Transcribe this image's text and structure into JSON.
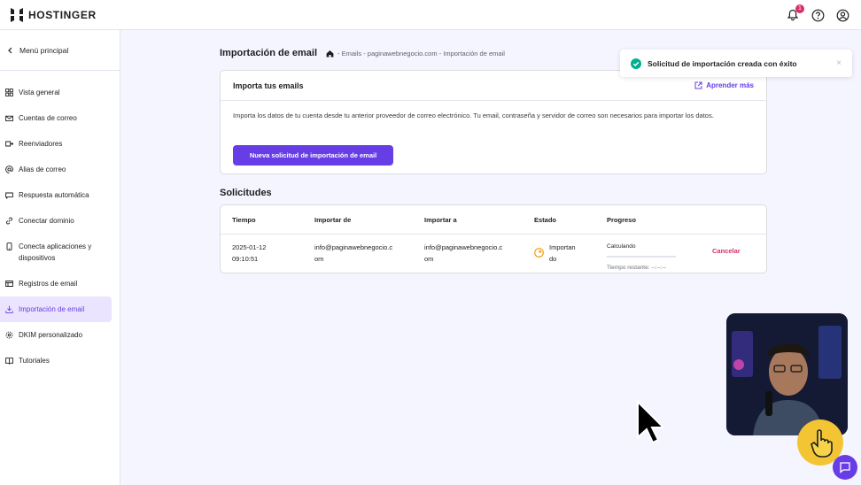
{
  "brand": {
    "name": "HOSTINGER"
  },
  "topbar": {
    "notification_count": "1"
  },
  "sidebar": {
    "back_label": "Menú principal",
    "items": [
      {
        "label": "Vista general",
        "icon": "dashboard-icon"
      },
      {
        "label": "Cuentas de correo",
        "icon": "mail-icon"
      },
      {
        "label": "Reenviadores",
        "icon": "forward-icon"
      },
      {
        "label": "Alias de correo",
        "icon": "at-icon"
      },
      {
        "label": "Respuesta automática",
        "icon": "reply-icon"
      },
      {
        "label": "Conectar dominio",
        "icon": "link-icon"
      },
      {
        "label": "Conecta aplicaciones y dispositivos",
        "icon": "devices-icon"
      },
      {
        "label": "Registros de email",
        "icon": "records-icon"
      },
      {
        "label": "Importación de email",
        "icon": "import-icon",
        "active": true
      },
      {
        "label": "DKIM personalizado",
        "icon": "gear-icon"
      },
      {
        "label": "Tutoriales",
        "icon": "book-icon"
      }
    ]
  },
  "header": {
    "title": "Importación de email",
    "breadcrumb": "- Emails - paginawebnegocio.com - Importación de email"
  },
  "import_card": {
    "title": "Importa tus emails",
    "learn_more": "Aprender más",
    "description": "Importa los datos de tu cuenta desde tu anterior proveedor de correo electrónico. Tu email, contraseña y servidor de correo son necesarios para importar los datos.",
    "button": "Nueva solicitud de importación de email"
  },
  "requests": {
    "title": "Solicitudes",
    "columns": [
      "Tiempo",
      "Importar de",
      "Importar a",
      "Estado",
      "Progreso"
    ],
    "rows": [
      {
        "time_line1": "2025-01-12",
        "time_line2": "09:10:51",
        "from_line1": "info@paginawebnegocio.c",
        "from_line2": "om",
        "to_line1": "info@paginawebnegocio.c",
        "to_line2": "om",
        "status_line1": "Importan",
        "status_line2": "do",
        "progress_label": "Calculando",
        "progress_fraction": 0,
        "remaining": "Tiempo restante: --:--:--",
        "cancel": "Cancelar"
      }
    ]
  },
  "toast": {
    "message": "Solicitud de importación creada con éxito",
    "close": "×"
  },
  "colors": {
    "accent": "#673de6",
    "danger": "#d63163",
    "success": "#00b090",
    "warning": "#f59e0b"
  }
}
